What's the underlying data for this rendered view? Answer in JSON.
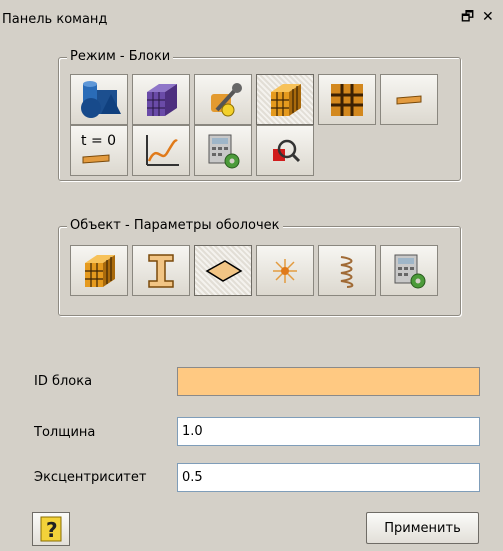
{
  "window": {
    "title": "Панель команд",
    "restore_glyph": "🗗",
    "close_glyph": "✕"
  },
  "mode_group": {
    "legend": "Режим - Блоки",
    "buttons": [
      {
        "icon": "geometry-shapes-icon"
      },
      {
        "icon": "mesh-cube-icon"
      },
      {
        "icon": "tools-icon"
      },
      {
        "icon": "block-cube-icon",
        "active": true
      },
      {
        "icon": "grid-node-icon"
      },
      {
        "icon": "shell-plate-icon"
      },
      {
        "icon": "initial-condition-icon",
        "text": "t = 0"
      },
      {
        "icon": "curve-graph-icon"
      },
      {
        "icon": "calculator-gear-icon"
      },
      {
        "icon": "zoom-select-icon"
      }
    ]
  },
  "object_group": {
    "legend": "Объект - Параметры оболочек",
    "buttons": [
      {
        "icon": "block-cube-icon"
      },
      {
        "icon": "i-beam-icon"
      },
      {
        "icon": "shell-diamond-icon",
        "active": true
      },
      {
        "icon": "point-burst-icon"
      },
      {
        "icon": "spring-icon"
      },
      {
        "icon": "calculator-gear-icon"
      }
    ]
  },
  "form": {
    "block_id": {
      "label": "ID блока",
      "value": ""
    },
    "thickness": {
      "label": "Толщина",
      "value": "1.0"
    },
    "eccentricity": {
      "label": "Эксцентриситет",
      "value": "0.5"
    }
  },
  "apply_label": "Применить",
  "colors": {
    "highlight_field": "#ffc982",
    "panel_bg": "#d4d0c8"
  }
}
